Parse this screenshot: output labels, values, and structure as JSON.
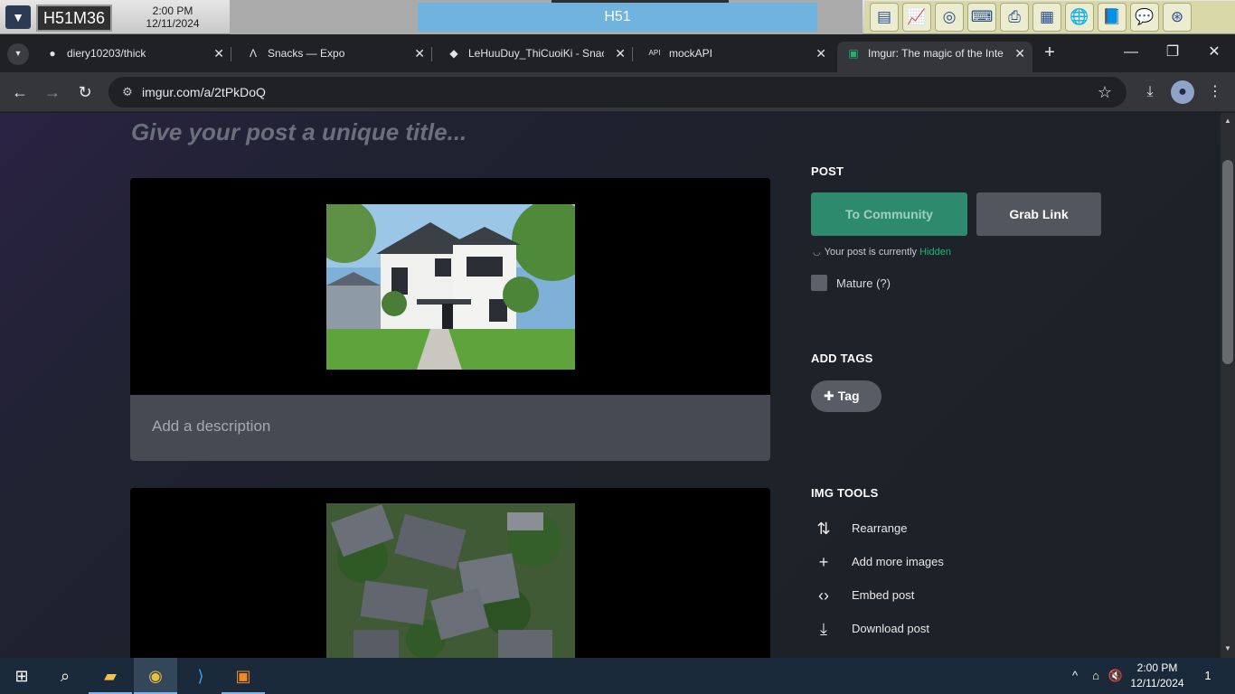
{
  "kiosk": {
    "machine": "H51M36",
    "time": "2:00 PM",
    "date": "12/11/2024",
    "room": "H51"
  },
  "tabs": [
    {
      "title": "diery10203/thick",
      "icon": "github-icon"
    },
    {
      "title": "Snacks — Expo",
      "icon": "expo-icon"
    },
    {
      "title": "LeHuuDuy_ThiCuoiKi - Snack",
      "icon": "snack-icon"
    },
    {
      "title": "mockAPI",
      "icon": "mockapi-icon"
    },
    {
      "title": "Imgur: The magic of the Inte",
      "icon": "imgur-icon"
    }
  ],
  "toolbar": {
    "url": "imgur.com/a/2tPkDoQ"
  },
  "post": {
    "title_placeholder": "Give your post a unique title...",
    "description_placeholder": "Add a description"
  },
  "sidebar": {
    "post_heading": "POST",
    "to_community": "To Community",
    "grab_link": "Grab Link",
    "status_prefix": "Your post is currently",
    "status_value": "Hidden",
    "mature_label": "Mature (?)",
    "tags_heading": "ADD TAGS",
    "tag_button": "Tag",
    "tools_heading": "IMG TOOLS",
    "tools": [
      {
        "label": "Rearrange",
        "icon": "rearrange-icon"
      },
      {
        "label": "Add more images",
        "icon": "plus-icon"
      },
      {
        "label": "Embed post",
        "icon": "code-icon"
      },
      {
        "label": "Download post",
        "icon": "download-icon"
      }
    ]
  },
  "taskbar": {
    "time": "2:00 PM",
    "date": "12/11/2024",
    "notifications": "1"
  },
  "colors": {
    "accent_green": "#2d8a6d",
    "hidden_status": "#1bb76e",
    "browser_tab_bg": "#202124"
  }
}
